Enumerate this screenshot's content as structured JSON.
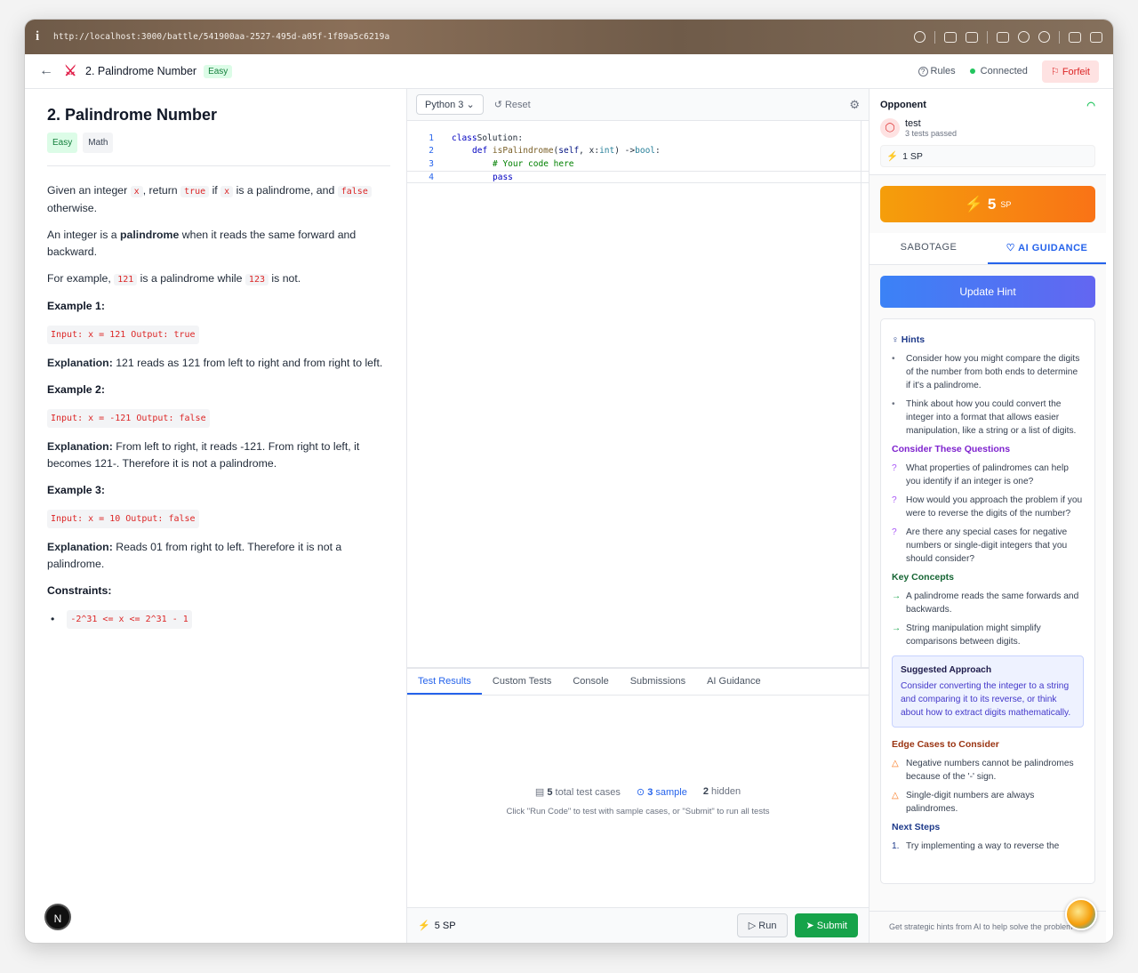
{
  "browser": {
    "url": "http://localhost:3000/battle/541900aa-2527-495d-a05f-1f89a5c6219a"
  },
  "nav": {
    "title": "2. Palindrome Number",
    "difficulty": "Easy",
    "rules": "Rules",
    "status": "Connected",
    "forfeit": "Forfeit"
  },
  "problem": {
    "title": "2. Palindrome Number",
    "tags": [
      "Easy",
      "Math"
    ],
    "p1": {
      "a": "Given an integer ",
      "x1": "x",
      "b": ", return ",
      "t": "true",
      "c": " if ",
      "x2": "x",
      "d": " is a palindrome, and ",
      "f": "false",
      "e": " otherwise."
    },
    "p2": {
      "a": "An integer is a ",
      "bold": "palindrome",
      "b": " when it reads the same forward and backward."
    },
    "p3": {
      "a": "For example, ",
      "c1": "121",
      "b": " is a palindrome while ",
      "c2": "123",
      "c": " is not."
    },
    "examples": [
      {
        "title": "Example 1:",
        "code": "Input: x = 121 Output: true",
        "label": "Explanation:",
        "text": " 121 reads as 121 from left to right and from right to left."
      },
      {
        "title": "Example 2:",
        "code": "Input: x = -121 Output: false",
        "label": "Explanation:",
        "text": " From left to right, it reads -121. From right to left, it becomes 121-. Therefore it is not a palindrome."
      },
      {
        "title": "Example 3:",
        "code": "Input: x = 10 Output: false",
        "label": "Explanation:",
        "text": " Reads 01 from right to left. Therefore it is not a palindrome."
      }
    ],
    "constraints_title": "Constraints:",
    "constraint": "-2^31 <= x <= 2^31 - 1"
  },
  "editor": {
    "language": "Python 3",
    "reset": "Reset",
    "lines": {
      "n1": "1",
      "n2": "2",
      "n3": "3",
      "n4": "4",
      "l1a": "class",
      "l1b": " Solution:",
      "l2a": "def",
      "l2b": "isPalindrome",
      "l2c": "(",
      "l2d": "self",
      "l2e": ", x: ",
      "l2f": "int",
      "l2g": ") -> ",
      "l2h": "bool",
      "l2i": ":",
      "l3": "# Your code here",
      "l4": "pass"
    }
  },
  "bottom_tabs": [
    "Test Results",
    "Custom Tests",
    "Console",
    "Submissions",
    "AI Guidance"
  ],
  "results": {
    "total_count": "5",
    "total_label": "total test cases",
    "sample_count": "3",
    "sample_label": "sample",
    "hidden_count": "2",
    "hidden_label": "hidden",
    "hint": "Click \"Run Code\" to test with sample cases, or \"Submit\" to run all tests"
  },
  "footer": {
    "sp": "5 SP",
    "run": "Run",
    "submit": "Submit"
  },
  "opponent": {
    "title": "Opponent",
    "name": "test",
    "tests": "3 tests passed",
    "sp": "1 SP"
  },
  "sp_display": {
    "value": "5",
    "unit": "SP"
  },
  "right_tabs": [
    "SABOTAGE",
    "AI GUIDANCE"
  ],
  "update_hint": "Update Hint",
  "guidance": {
    "hints_title": "Hints",
    "hints": [
      "Consider how you might compare the digits of the number from both ends to determine if it's a palindrome.",
      "Think about how you could convert the integer into a format that allows easier manipulation, like a string or a list of digits."
    ],
    "questions_title": "Consider These Questions",
    "questions": [
      "What properties of palindromes can help you identify if an integer is one?",
      "How would you approach the problem if you were to reverse the digits of the number?",
      "Are there any special cases for negative numbers or single-digit integers that you should consider?"
    ],
    "concepts_title": "Key Concepts",
    "concepts": [
      "A palindrome reads the same forwards and backwards.",
      "String manipulation might simplify comparisons between digits."
    ],
    "approach_title": "Suggested Approach",
    "approach_text": "Consider converting the integer to a string and comparing it to its reverse, or think about how to extract digits mathematically.",
    "edge_title": "Edge Cases to Consider",
    "edges": [
      "Negative numbers cannot be palindromes because of the '-' sign.",
      "Single-digit numbers are always palindromes."
    ],
    "next_title": "Next Steps",
    "next": [
      "Try implementing a way to reverse the"
    ]
  },
  "right_footer": "Get strategic hints from AI to help solve the problem",
  "colors": {
    "accent": "#2563eb",
    "orange": "#f97316",
    "green": "#16a34a",
    "red": "#dc2626"
  }
}
